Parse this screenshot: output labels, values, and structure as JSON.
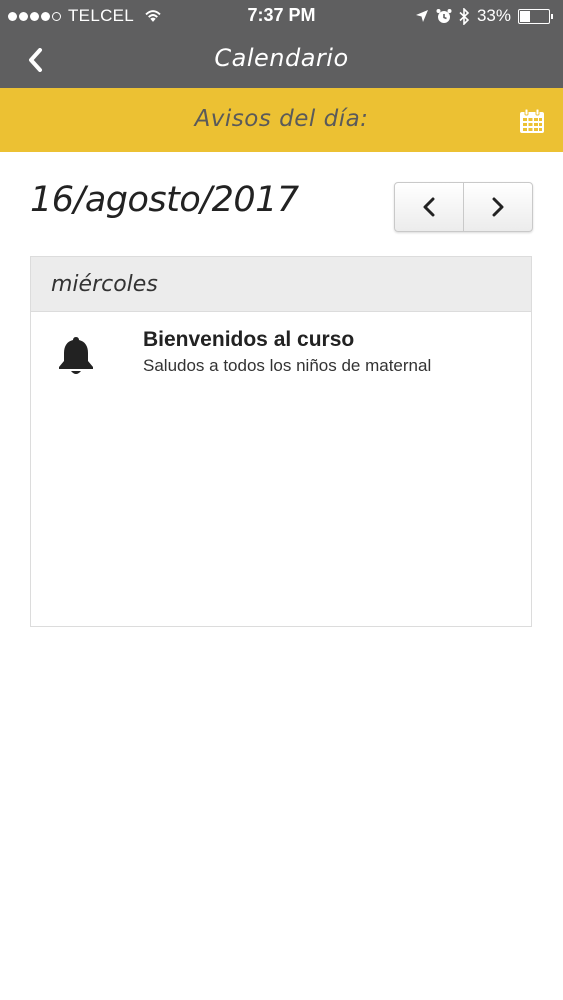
{
  "status_bar": {
    "carrier": "TELCEL",
    "time": "7:37 PM",
    "battery": "33%",
    "battery_level": 0.33,
    "signal_bars": 4
  },
  "nav": {
    "title": "Calendario",
    "back_icon": "chevron-left-icon"
  },
  "sub_header": {
    "title": "Avisos del día:",
    "calendar_icon": "calendar-icon",
    "accent_color": "#ecc133"
  },
  "date": {
    "current": "16/agosto/2017",
    "prev_icon": "chevron-left-icon",
    "next_icon": "chevron-right-icon"
  },
  "day": {
    "weekday": "miércoles",
    "notices": [
      {
        "icon": "bell-icon",
        "title": "Bienvenidos al curso",
        "body": "Saludos a todos los niños de maternal"
      }
    ]
  },
  "colors": {
    "header_bg": "#5f5f60",
    "accent": "#ecc133"
  }
}
